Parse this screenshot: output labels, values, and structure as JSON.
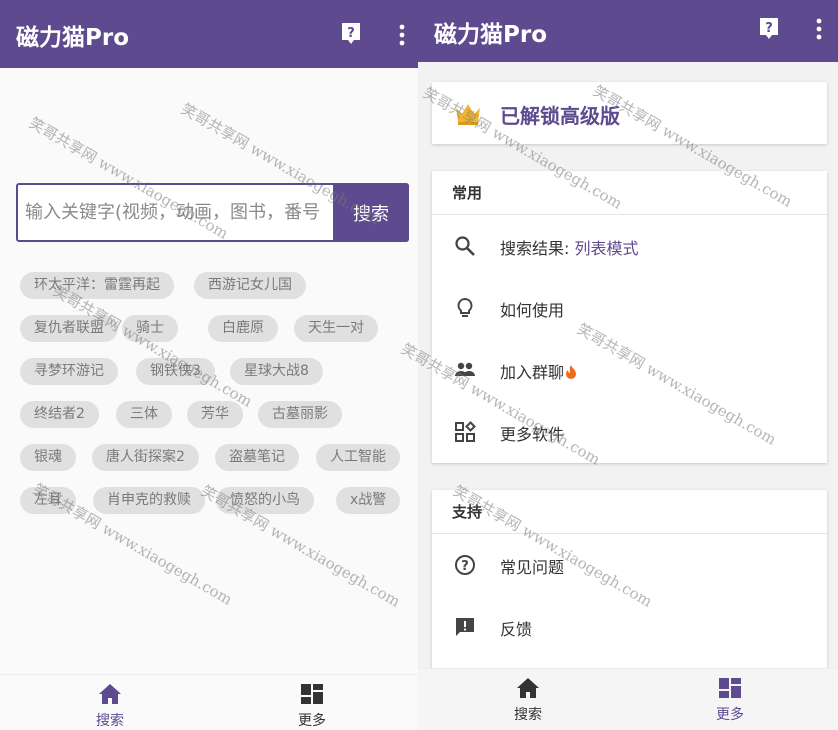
{
  "left": {
    "appbar": {
      "title": "磁力猫Pro"
    },
    "search": {
      "placeholder": "输入关键字(视频，动画，图书，番号",
      "button_label": "搜索"
    },
    "chips": [
      "环太平洋：雷霆再起",
      "西游记女儿国",
      "复仇者联盟",
      "骑士",
      "白鹿原",
      "天生一对",
      "寻梦环游记",
      "钢铁侠3",
      "星球大战8",
      "终结者2",
      "三体",
      "芳华",
      "古墓丽影",
      "银魂",
      "唐人街探案2",
      "盗墓笔记",
      "人工智能",
      "左耳",
      "肖申克的救赎",
      "愤怒的小鸟",
      "x战警"
    ],
    "bottomnav": {
      "search_label": "搜索",
      "more_label": "更多"
    }
  },
  "right": {
    "appbar": {
      "title": "磁力猫Pro"
    },
    "pro_banner": {
      "text": "已解锁高级版"
    },
    "common": {
      "title": "常用",
      "search_result_label": "搜索结果: ",
      "search_result_value": "列表模式",
      "how_to_use": "如何使用",
      "join_group": "加入群聊",
      "more_apps": "更多软件"
    },
    "support": {
      "title": "支持",
      "faq": "常见问题",
      "feedback": "反馈"
    },
    "bottomnav": {
      "search_label": "搜索",
      "more_label": "更多"
    }
  },
  "watermarks": [
    "笑哥共享网 www.xiaogegh.com"
  ],
  "colors": {
    "primary": "#5e4a8f",
    "chip_bg": "#e0e0e0",
    "crown": "#f2b632",
    "fire": "#f26a1b"
  }
}
